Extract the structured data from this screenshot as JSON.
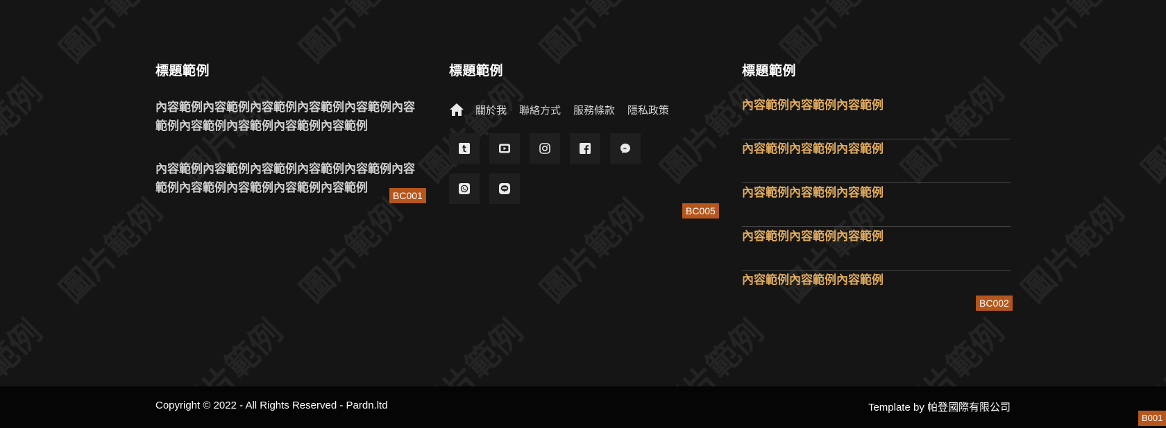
{
  "columns": {
    "about": {
      "title": "標題範例",
      "paragraphs": [
        "內容範例內容範例內容範例內容範例內容範例內容範例內容範例內容範例內容範例內容範例",
        "內容範例內容範例內容範例內容範例內容範例內容範例內容範例內容範例內容範例內容範例"
      ],
      "tag": "BC001"
    },
    "nav": {
      "title": "標題範例",
      "home_icon": "home-icon",
      "links": [
        "關於我",
        "聯絡方式",
        "服務條款",
        "隱私政策"
      ],
      "social_icons": [
        "tumblr-icon",
        "youtube-icon",
        "instagram-icon",
        "facebook-icon",
        "messenger-icon",
        "whatsapp-icon",
        "line-icon"
      ],
      "tag": "BC005"
    },
    "list": {
      "title": "標題範例",
      "items": [
        "內容範例內容範例內容範例",
        "內容範例內容範例內容範例",
        "內容範例內容範例內容範例",
        "內容範例內容範例內容範例",
        "內容範例內容範例內容範例"
      ],
      "tag": "BC002"
    }
  },
  "watermark_text": "圖片範例",
  "bottom": {
    "copyright": "Copyright © 2022 - All Rights Reserved - Pardn.ltd",
    "template_by": "Template by 帕登國際有限公司",
    "tag": "B001"
  },
  "colors": {
    "background": "#151515",
    "bottom_bar": "#050505",
    "accent_link": "#e0ac5e",
    "tag": "#b5561c"
  }
}
